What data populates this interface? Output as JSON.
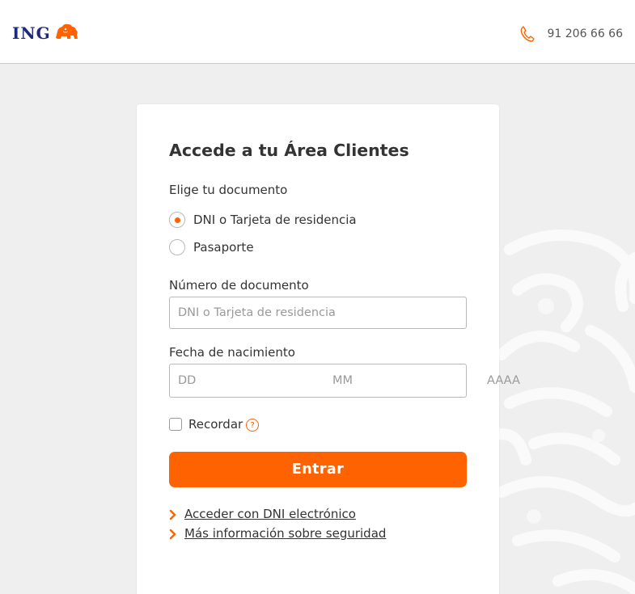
{
  "header": {
    "logo_text": "ING",
    "logo_icon": "ing-lion-icon",
    "phone_icon": "phone-icon",
    "phone_number": "91 206 66 66",
    "brand_color": "#ff6200",
    "logo_color": "#1d2a7a"
  },
  "login": {
    "title": "Accede a tu Área Clientes",
    "document_label": "Elige tu documento",
    "options": [
      {
        "label": "DNI o Tarjeta de residencia",
        "selected": true
      },
      {
        "label": "Pasaporte",
        "selected": false
      }
    ],
    "doc_number_label": "Número de documento",
    "doc_number_placeholder": "DNI o Tarjeta de residencia",
    "doc_number_value": "",
    "birth_label": "Fecha de nacimiento",
    "birth_day_placeholder": "DD",
    "birth_month_placeholder": "MM",
    "birth_year_placeholder": "AAAA",
    "remember_label": "Recordar",
    "remember_checked": false,
    "help_icon_glyph": "?",
    "submit_label": "Entrar",
    "links": [
      {
        "label": "Acceder con DNI electrónico"
      },
      {
        "label": "Más información sobre seguridad"
      }
    ]
  }
}
